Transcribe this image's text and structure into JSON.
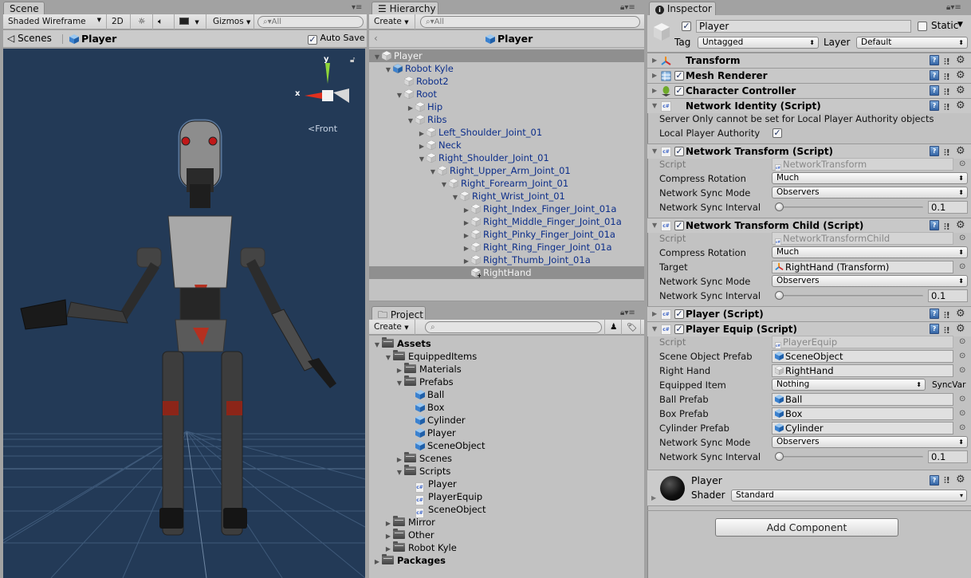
{
  "scene": {
    "tab_label": "Scene",
    "toolbar": {
      "draw_mode": "Shaded Wireframe",
      "two_d": "2D",
      "gizmos": "Gizmos",
      "search_placeholder": "All"
    },
    "breadcrumb": {
      "scenes": "Scenes",
      "prefab": "Player"
    },
    "auto_save_label": "Auto Save",
    "auto_save_checked": true,
    "gizmo": {
      "x_label": "x",
      "y_label": "y",
      "view_label": "Front"
    },
    "colors": {
      "background": "#233a57",
      "x_axis": "#e0301e",
      "y_axis": "#8fd63a"
    }
  },
  "hierarchy": {
    "tab_label": "Hierarchy",
    "create_label": "Create",
    "search_placeholder": "All",
    "prefab_title": "Player",
    "items": [
      {
        "label": "Player",
        "depth": 0,
        "expand": "open",
        "icon": "cube-gray",
        "style": "root",
        "selected": true
      },
      {
        "label": "Robot Kyle",
        "depth": 1,
        "expand": "open",
        "icon": "prefab-blue",
        "style": "blue"
      },
      {
        "label": "Robot2",
        "depth": 2,
        "expand": "none",
        "icon": "cube-gray",
        "style": "blue"
      },
      {
        "label": "Root",
        "depth": 2,
        "expand": "open",
        "icon": "cube-gray",
        "style": "blue"
      },
      {
        "label": "Hip",
        "depth": 3,
        "expand": "closed",
        "icon": "cube-gray",
        "style": "blue"
      },
      {
        "label": "Ribs",
        "depth": 3,
        "expand": "open",
        "icon": "cube-gray",
        "style": "blue"
      },
      {
        "label": "Left_Shoulder_Joint_01",
        "depth": 4,
        "expand": "closed",
        "icon": "cube-gray",
        "style": "blue"
      },
      {
        "label": "Neck",
        "depth": 4,
        "expand": "closed",
        "icon": "cube-gray",
        "style": "blue"
      },
      {
        "label": "Right_Shoulder_Joint_01",
        "depth": 4,
        "expand": "open",
        "icon": "cube-gray",
        "style": "blue"
      },
      {
        "label": "Right_Upper_Arm_Joint_01",
        "depth": 5,
        "expand": "open",
        "icon": "cube-gray",
        "style": "blue"
      },
      {
        "label": "Right_Forearm_Joint_01",
        "depth": 6,
        "expand": "open",
        "icon": "cube-gray",
        "style": "blue"
      },
      {
        "label": "Right_Wrist_Joint_01",
        "depth": 7,
        "expand": "open",
        "icon": "cube-gray",
        "style": "blue"
      },
      {
        "label": "Right_Index_Finger_Joint_01a",
        "depth": 8,
        "expand": "closed",
        "icon": "cube-gray",
        "style": "blue"
      },
      {
        "label": "Right_Middle_Finger_Joint_01a",
        "depth": 8,
        "expand": "closed",
        "icon": "cube-gray",
        "style": "blue"
      },
      {
        "label": "Right_Pinky_Finger_Joint_01a",
        "depth": 8,
        "expand": "closed",
        "icon": "cube-gray",
        "style": "blue"
      },
      {
        "label": "Right_Ring_Finger_Joint_01a",
        "depth": 8,
        "expand": "closed",
        "icon": "cube-gray",
        "style": "blue"
      },
      {
        "label": "Right_Thumb_Joint_01a",
        "depth": 8,
        "expand": "closed",
        "icon": "cube-gray",
        "style": "blue"
      },
      {
        "label": "RightHand",
        "depth": 8,
        "expand": "none",
        "icon": "cube-added",
        "style": "white",
        "selected": true
      }
    ]
  },
  "project": {
    "tab_label": "Project",
    "create_label": "Create",
    "items": [
      {
        "label": "Assets",
        "depth": 0,
        "expand": "open",
        "icon": "folder",
        "bold": true
      },
      {
        "label": "EquippedItems",
        "depth": 1,
        "expand": "open",
        "icon": "folder"
      },
      {
        "label": "Materials",
        "depth": 2,
        "expand": "closed",
        "icon": "folder"
      },
      {
        "label": "Prefabs",
        "depth": 2,
        "expand": "open",
        "icon": "folder"
      },
      {
        "label": "Ball",
        "depth": 3,
        "expand": "none",
        "icon": "prefab"
      },
      {
        "label": "Box",
        "depth": 3,
        "expand": "none",
        "icon": "prefab"
      },
      {
        "label": "Cylinder",
        "depth": 3,
        "expand": "none",
        "icon": "prefab"
      },
      {
        "label": "Player",
        "depth": 3,
        "expand": "none",
        "icon": "prefab"
      },
      {
        "label": "SceneObject",
        "depth": 3,
        "expand": "none",
        "icon": "prefab"
      },
      {
        "label": "Scenes",
        "depth": 2,
        "expand": "closed",
        "icon": "folder"
      },
      {
        "label": "Scripts",
        "depth": 2,
        "expand": "open",
        "icon": "folder"
      },
      {
        "label": "Player",
        "depth": 3,
        "expand": "none",
        "icon": "cs-script"
      },
      {
        "label": "PlayerEquip",
        "depth": 3,
        "expand": "none",
        "icon": "cs-script"
      },
      {
        "label": "SceneObject",
        "depth": 3,
        "expand": "none",
        "icon": "cs-script"
      },
      {
        "label": "Mirror",
        "depth": 1,
        "expand": "closed",
        "icon": "folder"
      },
      {
        "label": "Other",
        "depth": 1,
        "expand": "closed",
        "icon": "folder"
      },
      {
        "label": "Robot Kyle",
        "depth": 1,
        "expand": "closed",
        "icon": "folder"
      },
      {
        "label": "Packages",
        "depth": 0,
        "expand": "closed",
        "icon": "folder",
        "bold": true
      }
    ]
  },
  "inspector": {
    "tab_label": "Inspector",
    "object_name": "Player",
    "active": true,
    "static_label": "Static",
    "static_checked": false,
    "tag_label": "Tag",
    "tag_value": "Untagged",
    "layer_label": "Layer",
    "layer_value": "Default",
    "components": {
      "transform": {
        "title": "Transform",
        "expanded": false
      },
      "mesh_renderer": {
        "title": "Mesh Renderer",
        "enabled": true,
        "expanded": false
      },
      "character_controller": {
        "title": "Character Controller",
        "enabled": true,
        "expanded": false
      },
      "network_identity": {
        "title": "Network Identity (Script)",
        "expanded": true,
        "warning": "Server Only cannot be set for Local Player Authority objects",
        "local_player_authority_label": "Local Player Authority",
        "local_player_authority": true
      },
      "network_transform": {
        "title": "Network Transform (Script)",
        "enabled": true,
        "expanded": true,
        "script_label": "Script",
        "script_value": "NetworkTransform",
        "compress_rotation_label": "Compress Rotation",
        "compress_rotation": "Much",
        "sync_mode_label": "Network Sync Mode",
        "sync_mode": "Observers",
        "sync_interval_label": "Network Sync Interval",
        "sync_interval": "0.1",
        "sync_interval_fraction": 0.0
      },
      "network_transform_child": {
        "title": "Network Transform Child (Script)",
        "enabled": true,
        "expanded": true,
        "script_label": "Script",
        "script_value": "NetworkTransformChild",
        "compress_rotation_label": "Compress Rotation",
        "compress_rotation": "Much",
        "target_label": "Target",
        "target_value": "RightHand (Transform)",
        "sync_mode_label": "Network Sync Mode",
        "sync_mode": "Observers",
        "sync_interval_label": "Network Sync Interval",
        "sync_interval": "0.1",
        "sync_interval_fraction": 0.0
      },
      "player": {
        "title": "Player (Script)",
        "enabled": true,
        "expanded": false
      },
      "player_equip": {
        "title": "Player Equip (Script)",
        "enabled": true,
        "expanded": true,
        "script_label": "Script",
        "script_value": "PlayerEquip",
        "scene_object_prefab_label": "Scene Object Prefab",
        "scene_object_prefab": "SceneObject",
        "right_hand_label": "Right Hand",
        "right_hand": "RightHand",
        "equipped_item_label": "Equipped Item",
        "equipped_item": "Nothing",
        "syncvar_label": "SyncVar",
        "ball_prefab_label": "Ball Prefab",
        "ball_prefab": "Ball",
        "box_prefab_label": "Box Prefab",
        "box_prefab": "Box",
        "cylinder_prefab_label": "Cylinder Prefab",
        "cylinder_prefab": "Cylinder",
        "sync_mode_label": "Network Sync Mode",
        "sync_mode": "Observers",
        "sync_interval_label": "Network Sync Interval",
        "sync_interval": "0.1",
        "sync_interval_fraction": 0.0
      }
    },
    "material": {
      "name": "Player",
      "shader_label": "Shader",
      "shader_value": "Standard"
    },
    "add_component_label": "Add Component"
  }
}
